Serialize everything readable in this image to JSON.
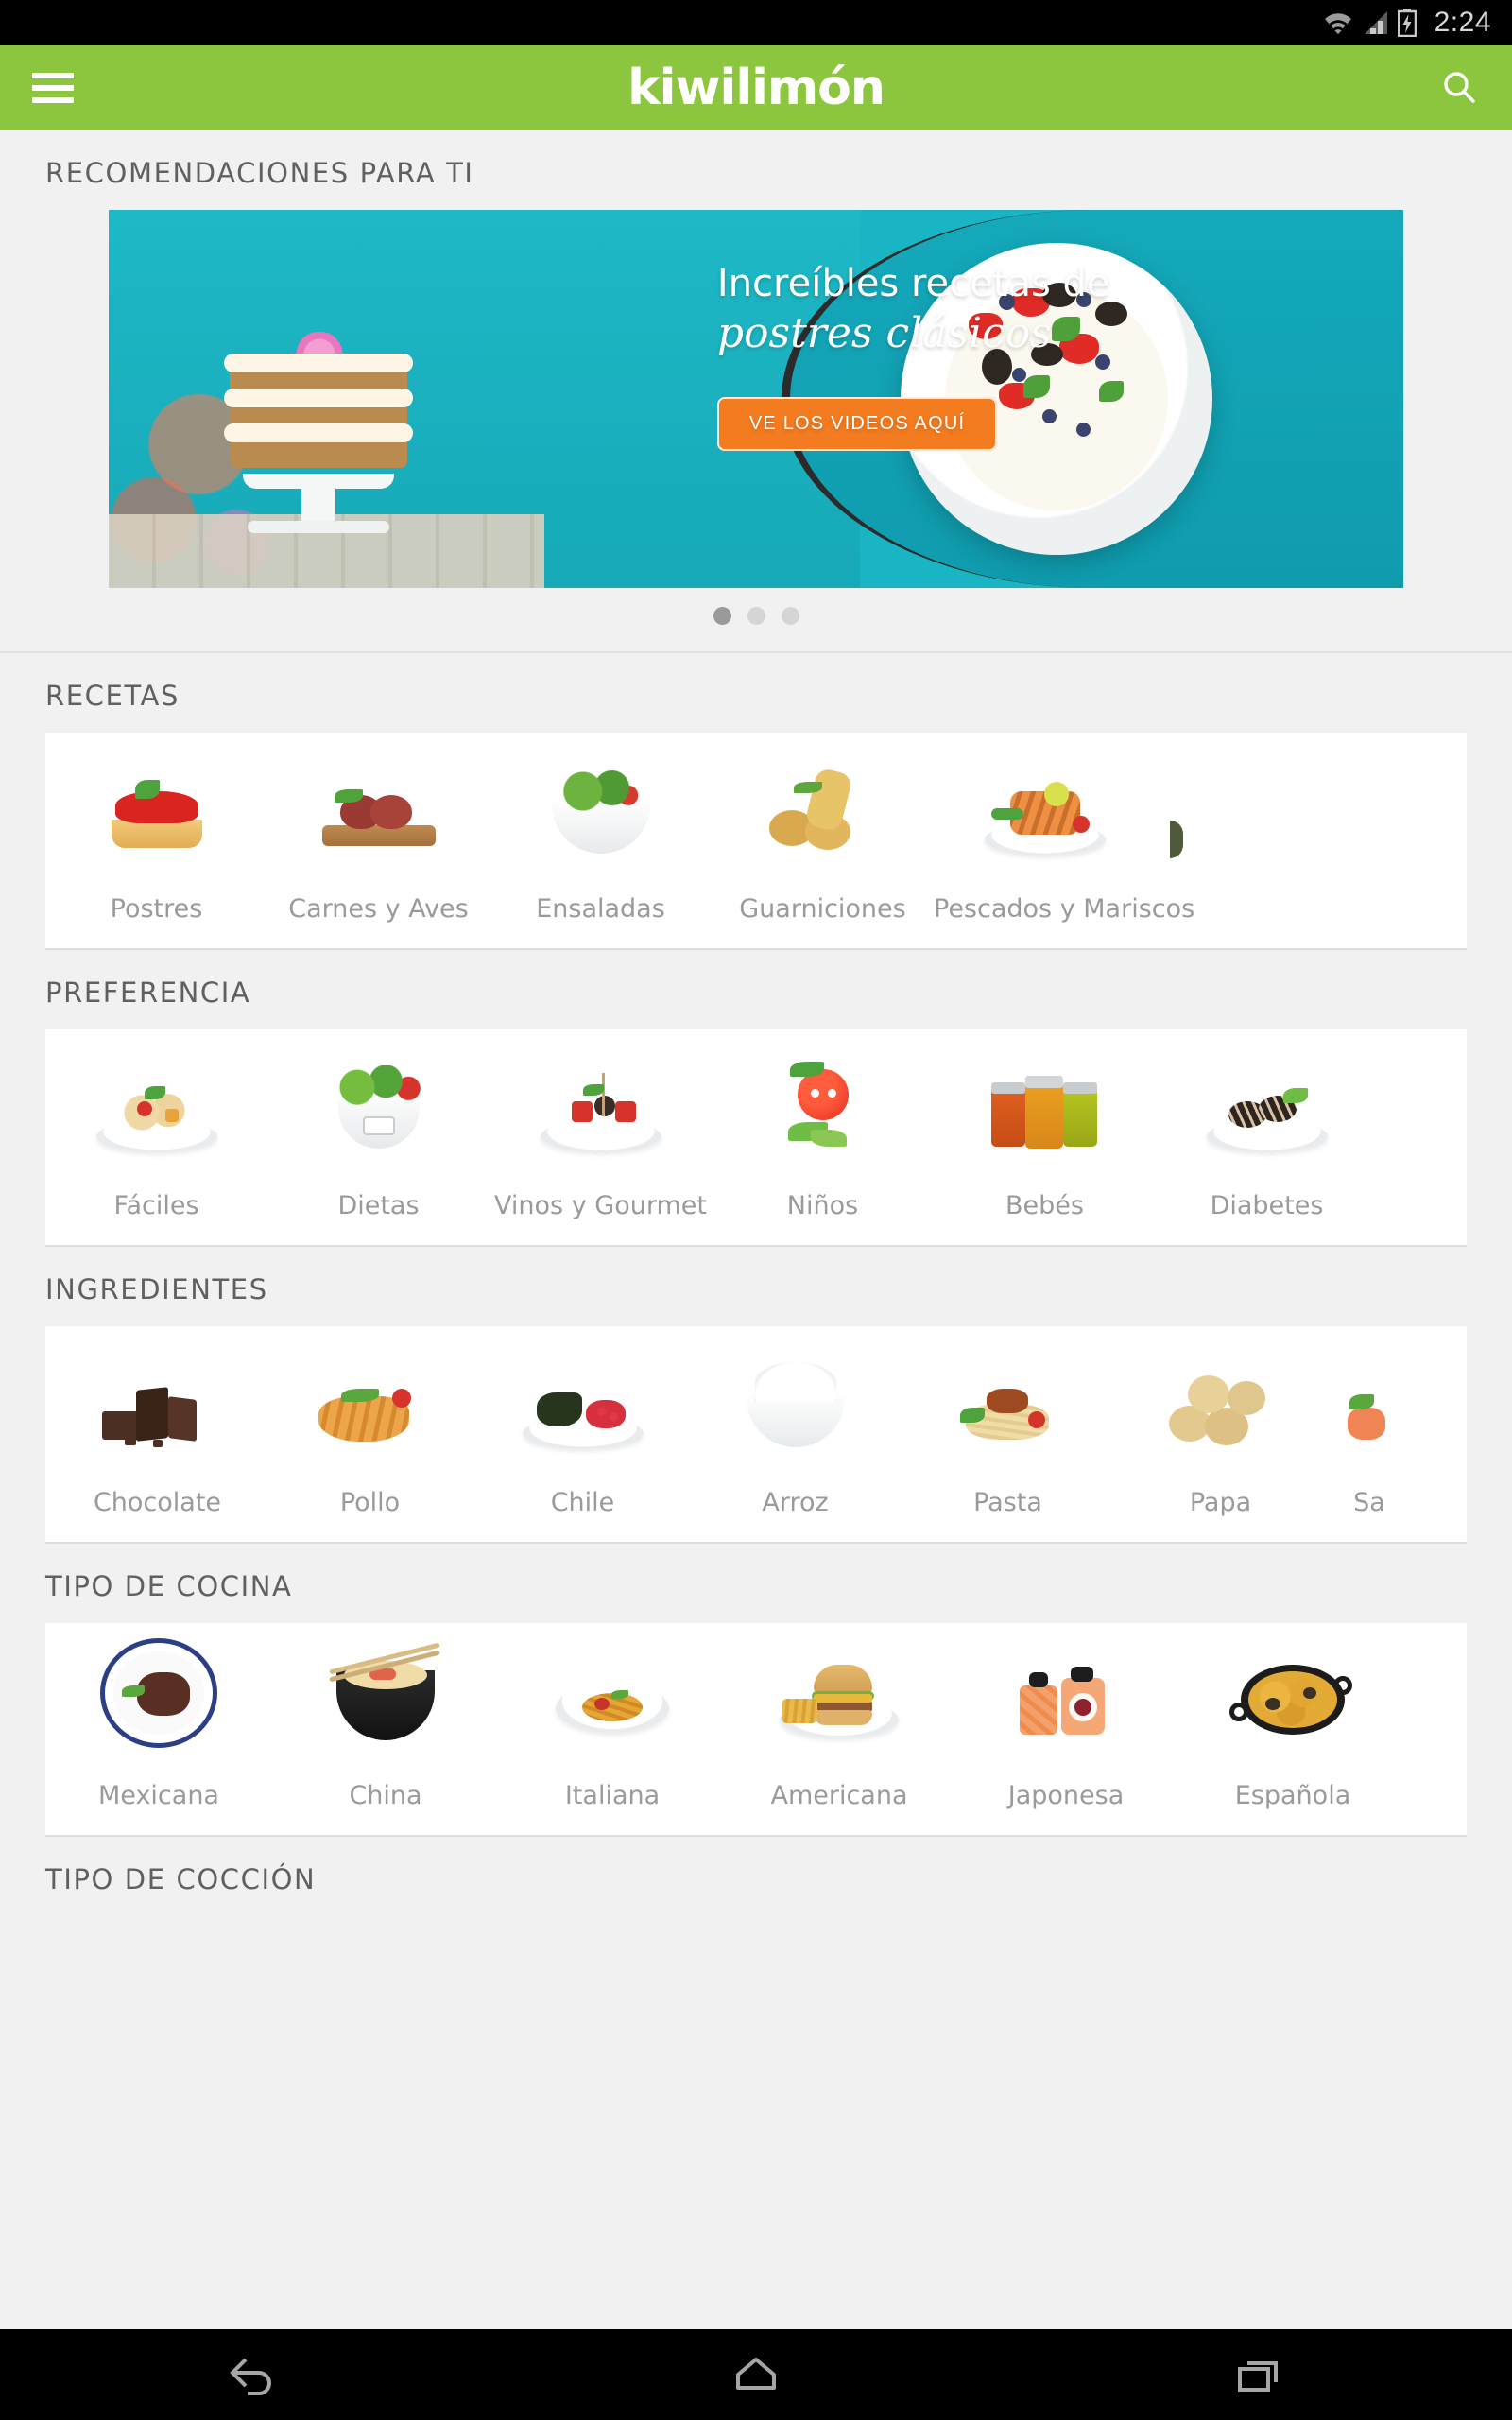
{
  "status_bar": {
    "time": "2:24",
    "icons": [
      "wifi-icon",
      "cell-signal-icon",
      "battery-charging-icon"
    ]
  },
  "app_bar": {
    "menu_icon": "hamburger-menu-icon",
    "brand": "kiwilimón",
    "search_icon": "search-icon",
    "background_color": "#8cc63f"
  },
  "sections": {
    "recommendations": {
      "title": "RECOMENDACIONES PARA TI",
      "banner": {
        "line1": "Increíbles recetas de",
        "line2": "postres clásicos",
        "cta": "VE LOS VIDEOS AQUÍ",
        "cta_color": "#f47c20",
        "background_color": "#19b5c4"
      },
      "pagination": {
        "total": 3,
        "active_index": 0
      }
    },
    "recetas": {
      "title": "RECETAS",
      "items": [
        {
          "label": "Postres",
          "icon": "tart-icon"
        },
        {
          "label": "Carnes y Aves",
          "icon": "steak-icon"
        },
        {
          "label": "Ensaladas",
          "icon": "salad-bowl-icon"
        },
        {
          "label": "Guarniciones",
          "icon": "potatoes-icon"
        },
        {
          "label": "Pescados y Mariscos",
          "icon": "grilled-fish-icon"
        },
        {
          "label": "",
          "icon": "cut-off-item-icon"
        }
      ]
    },
    "preferencia": {
      "title": "PREFERENCIA",
      "items": [
        {
          "label": "Fáciles",
          "icon": "pasta-plate-icon"
        },
        {
          "label": "Dietas",
          "icon": "salad-scale-icon"
        },
        {
          "label": "Vinos y Gourmet",
          "icon": "gourmet-skewers-icon"
        },
        {
          "label": "Niños",
          "icon": "tomato-face-icon"
        },
        {
          "label": "Bebés",
          "icon": "baby-food-jars-icon"
        },
        {
          "label": "Diabetes",
          "icon": "dessert-plate-icon"
        }
      ]
    },
    "ingredientes": {
      "title": "INGREDIENTES",
      "items": [
        {
          "label": "Chocolate",
          "icon": "chocolate-icon"
        },
        {
          "label": "Pollo",
          "icon": "chicken-breast-icon"
        },
        {
          "label": "Chile",
          "icon": "chile-plate-icon"
        },
        {
          "label": "Arroz",
          "icon": "rice-bowl-icon"
        },
        {
          "label": "Pasta",
          "icon": "pasta-icon"
        },
        {
          "label": "Papa",
          "icon": "potato-icon"
        },
        {
          "label": "Sa",
          "icon": "salmon-icon"
        }
      ]
    },
    "tipo_de_cocina": {
      "title": "TIPO DE COCINA",
      "items": [
        {
          "label": "Mexicana",
          "icon": "mole-plate-icon"
        },
        {
          "label": "China",
          "icon": "noodle-bowl-icon"
        },
        {
          "label": "Italiana",
          "icon": "italian-pasta-icon"
        },
        {
          "label": "Americana",
          "icon": "burger-icon"
        },
        {
          "label": "Japonesa",
          "icon": "sushi-icon"
        },
        {
          "label": "Española",
          "icon": "paella-icon"
        }
      ]
    },
    "tipo_de_coccion": {
      "title": "TIPO DE COCCIÓN"
    }
  },
  "nav_bar": {
    "back": "back-icon",
    "home": "home-icon",
    "recents": "recents-icon"
  }
}
